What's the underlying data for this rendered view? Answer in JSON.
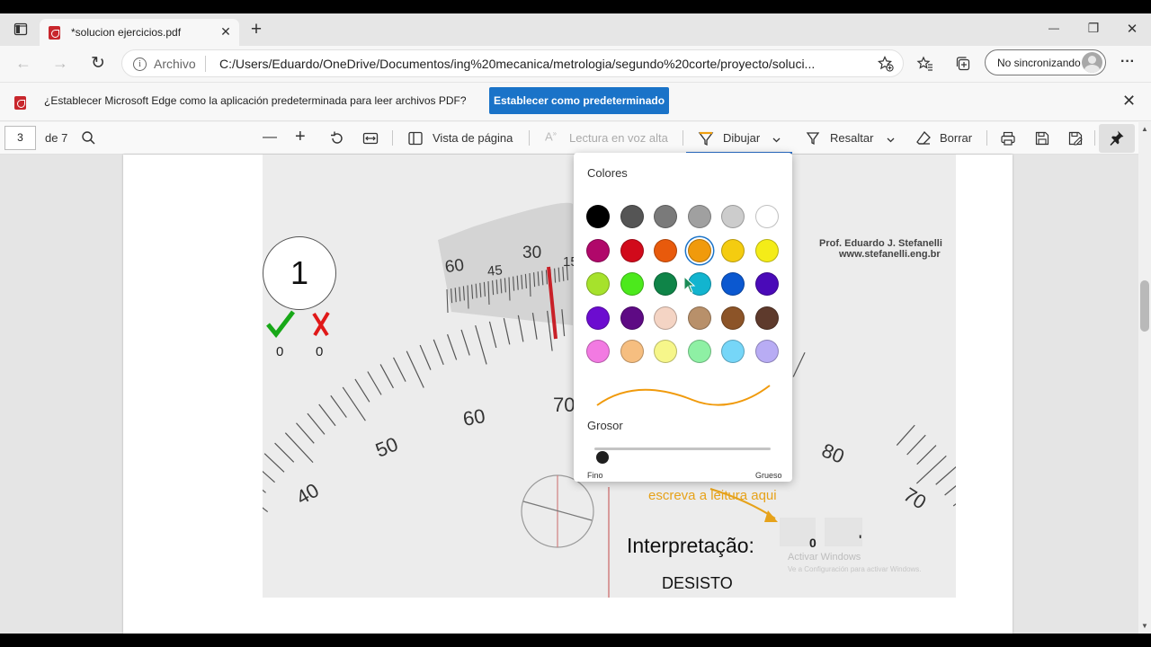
{
  "browser": {
    "tab_title": "*solucion ejercicios.pdf",
    "tab_close": "✕",
    "new_tab": "+",
    "window_controls": {
      "minimize": "—",
      "restore": "❐",
      "close": "✕"
    },
    "address": {
      "back": "←",
      "forward": "→",
      "refresh": "↻",
      "info_glyph": "i",
      "label": "Archivo",
      "url": "C:/Users/Eduardo/OneDrive/Documentos/ing%20mecanica/metrologia/segundo%20corte/proyecto/soluci..."
    },
    "sync_label": "No sincronizando",
    "menu_glyph": "···"
  },
  "infobar": {
    "message": "¿Establecer Microsoft Edge como la aplicación predeterminada para leer archivos PDF?",
    "button": "Establecer como predeterminado",
    "close": "✕"
  },
  "pdf_toolbar": {
    "page_number": "3",
    "page_total": "de 7",
    "zoom_out": "—",
    "zoom_in": "+",
    "page_view": "Vista de página",
    "read_aloud": "Lectura en voz alta",
    "draw": "Dibujar",
    "highlight": "Resaltar",
    "erase": "Borrar"
  },
  "document": {
    "counter": "1",
    "correct_count": "0",
    "wrong_count": "0",
    "author": "Prof. Eduardo J. Stefanelli",
    "website": "www.stefanelli.eng.br",
    "dial_outer": [
      "40",
      "50",
      "60",
      "70",
      "80",
      "70"
    ],
    "dial_inner": [
      "60",
      "45",
      "30",
      "15"
    ],
    "hint": "escreva a leitura aqui",
    "interpretation_label": "Interpretação:",
    "answer": "DESISTO",
    "value_box_1": "0",
    "value_box_2": "'",
    "watermark_title": "Activar Windows",
    "watermark_sub": "Ve a Configuración para activar Windows."
  },
  "draw_flyout": {
    "colors_label": "Colores",
    "colors": [
      [
        "#000000",
        "#555555",
        "#7a7a7a",
        "#a0a0a0",
        "#cccccc",
        "#ffffff"
      ],
      [
        "#b0086a",
        "#d10a1b",
        "#e85a0c",
        "#f09a0c",
        "#f4cc10",
        "#f4ec18"
      ],
      [
        "#a6e22c",
        "#4ce91c",
        "#0f8448",
        "#12b4cf",
        "#0b58d0",
        "#4a0ab8"
      ],
      [
        "#6c0cd0",
        "#5e0a84",
        "#f4d4c4",
        "#b8906a",
        "#8c5428",
        "#5e3a2c"
      ],
      [
        "#f27ae2",
        "#f6be80",
        "#f6f68a",
        "#8ef0a4",
        "#76d6f8",
        "#b8acf4"
      ]
    ],
    "selected_color": "#f09a0c",
    "thickness_label": "Grosor",
    "thickness_level": 0,
    "min_label": "Fino",
    "max_label": "Grueso"
  }
}
